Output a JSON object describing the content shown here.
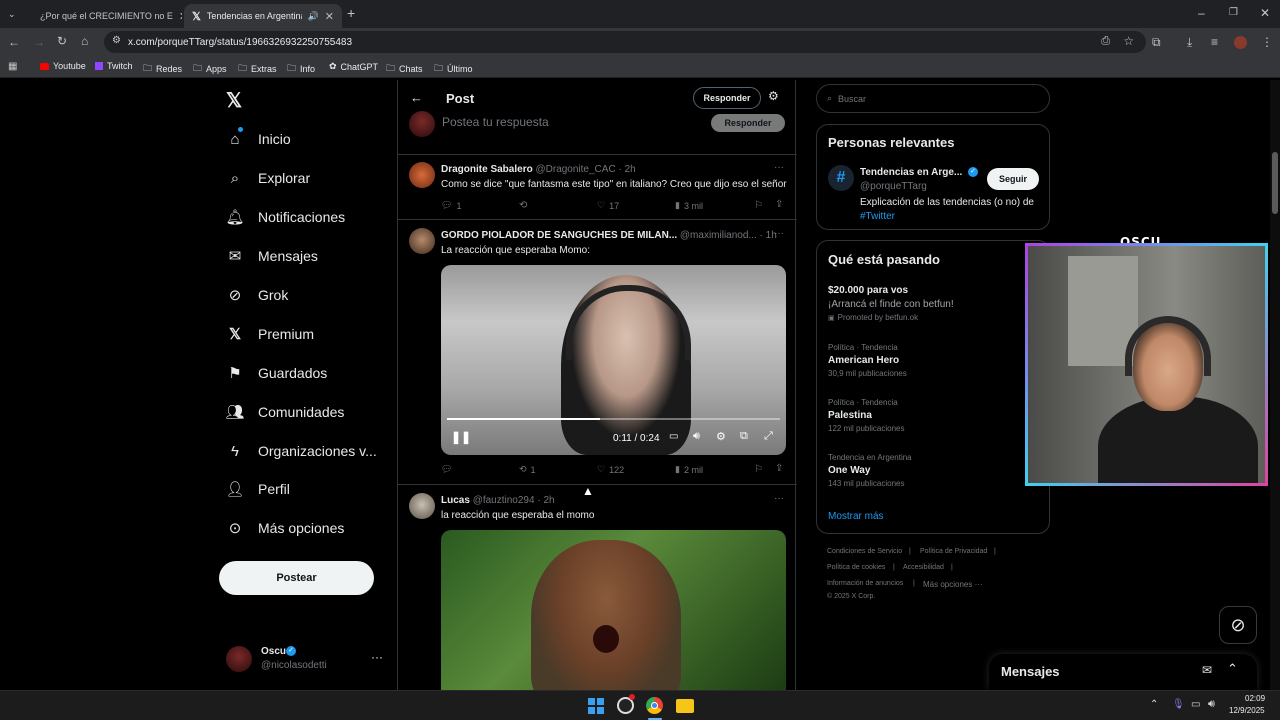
{
  "browser": {
    "tabs": [
      {
        "title": "¿Por qué el CRECIMIENTO no E",
        "active": false,
        "favicon_color": "#ff0000"
      },
      {
        "title": "Tendencias en Argentina en",
        "active": true,
        "favicon_color": "#ffffff"
      }
    ],
    "url": "x.com/porqueTTarg/status/1966326932250755483",
    "bookmarks": [
      "Youtube",
      "Twitch",
      "Redes",
      "Apps",
      "Extras",
      "Info",
      "ChatGPT",
      "Chats",
      "Último"
    ]
  },
  "nav": {
    "items": [
      {
        "label": "Inicio",
        "icon": "home-icon"
      },
      {
        "label": "Explorar",
        "icon": "search-icon"
      },
      {
        "label": "Notificaciones",
        "icon": "bell-icon"
      },
      {
        "label": "Mensajes",
        "icon": "mail-icon"
      },
      {
        "label": "Grok",
        "icon": "grok-icon"
      },
      {
        "label": "Premium",
        "icon": "x-icon"
      },
      {
        "label": "Guardados",
        "icon": "bookmark-icon"
      },
      {
        "label": "Comunidades",
        "icon": "people-icon"
      },
      {
        "label": "Organizaciones v...",
        "icon": "bolt-icon"
      },
      {
        "label": "Perfil",
        "icon": "person-icon"
      },
      {
        "label": "Más opciones",
        "icon": "more-icon"
      }
    ],
    "post_button": "Postear",
    "account": {
      "name": "Oscu",
      "handle": "@nicolasodetti"
    }
  },
  "post_header": {
    "title": "Post",
    "reply_button": "Responder",
    "compose_placeholder": "Postea tu respuesta",
    "compose_button": "Responder"
  },
  "tweets": [
    {
      "name": "Dragonite Sabalero",
      "handle": "@Dragonite_CAC",
      "time": "· 2h",
      "text": "Como se dice \"que fantasma este tipo\" en italiano? Creo que dijo eso el señor",
      "replies": "1",
      "retweets": "",
      "likes": "17",
      "views": "3 mil"
    },
    {
      "name": "GORDO PIOLADOR DE SANGUCHES DE MILAN...",
      "handle": "@maximilianod...",
      "time": "· 1h",
      "text": "La reacción que esperaba Momo:",
      "replies": "",
      "retweets": "1",
      "likes": "122",
      "views": "2 mil",
      "video": {
        "time": "0:11 / 0:24",
        "progress": 0.46
      }
    },
    {
      "name": "Lucas",
      "handle": "@fauztino294",
      "time": "· 2h",
      "text": "la reacción que esperaba el momo"
    }
  ],
  "sidebar": {
    "search_placeholder": "Buscar",
    "relevant": {
      "title": "Personas relevantes",
      "name": "Tendencias en Arge...",
      "handle": "@porqueTTarg",
      "follow": "Seguir",
      "bio": "Explicación de las tendencias (o no) de",
      "bio_tag": "#Twitter"
    },
    "happening": {
      "title": "Qué está pasando",
      "promo_title": "$20.000 para vos",
      "promo_text": "¡Arrancá el finde con betfun!",
      "promo_by": "Promoted by betfun.ok",
      "trends": [
        {
          "cat": "Política · Tendencia",
          "name": "American Hero",
          "count": "30,9 mil publicaciones"
        },
        {
          "cat": "Política · Tendencia",
          "name": "Palestina",
          "count": "122 mil publicaciones"
        },
        {
          "cat": "Tendencia en Argentina",
          "name": "One Way",
          "count": "143 mil publicaciones"
        }
      ],
      "show_more": "Mostrar más"
    },
    "footer": [
      "Condiciones de Servicio",
      "Política de Privacidad",
      "Política de cookies",
      "Accesibilidad",
      "Información de anuncios",
      "Más opciones ···",
      "© 2025 X Corp."
    ]
  },
  "overlay": {
    "label": "OSCU"
  },
  "messages_drawer": {
    "title": "Mensajes"
  },
  "taskbar": {
    "time": "02:09",
    "date": "12/9/2025"
  },
  "colors": {
    "accent": "#1d9bf0",
    "bg": "#000000",
    "border": "#2f3336"
  }
}
